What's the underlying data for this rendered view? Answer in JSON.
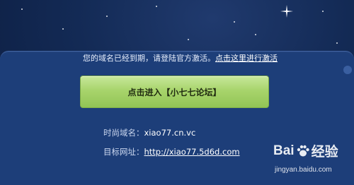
{
  "notice": {
    "text": "您的域名已经到期，请登陆官方激活。",
    "link_label": "点击这里进行激活"
  },
  "enter_button": {
    "label": "点击进入【小七七论坛】"
  },
  "info": {
    "domain_label": "时尚域名：",
    "domain_value": "xiao77.cn.vc",
    "target_label": "目标网址：",
    "target_value": "http://xiao77.5d6d.com"
  },
  "watermark": {
    "brand": "Bai",
    "brand_suffix": "经验",
    "domain": "jingyan.baidu.com",
    "icon": "baidu-paw-icon"
  },
  "colors": {
    "background": "#132a55",
    "panel": "#1d3e79",
    "button": "#a8d46c",
    "text": "#e7eefc"
  }
}
